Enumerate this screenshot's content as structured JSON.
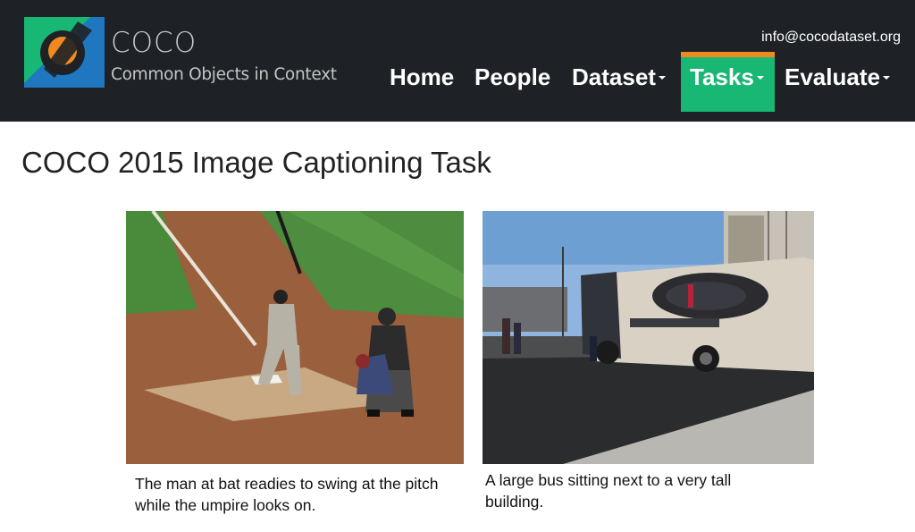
{
  "header": {
    "brand_name": "COCO",
    "brand_tagline": "Common Objects in Context",
    "contact_email": "info@cocodataset.org",
    "nav": {
      "home": "Home",
      "people": "People",
      "dataset": "Dataset",
      "tasks": "Tasks",
      "evaluate": "Evaluate"
    },
    "active_nav": "Tasks",
    "colors": {
      "header_bg": "#1e2126",
      "active_tab": "#19b774",
      "active_tab_border": "#f08a1f",
      "logo_green": "#19b774",
      "logo_blue": "#1f77bf",
      "logo_orange": "#f08a1f"
    }
  },
  "main": {
    "title": "COCO 2015 Image Captioning Task",
    "examples": [
      {
        "image": "baseball-photo",
        "caption": "The man at bat readies to swing at the pitch while the umpire looks on."
      },
      {
        "image": "bus-photo",
        "caption": "A large bus sitting next to a very tall building."
      }
    ]
  }
}
